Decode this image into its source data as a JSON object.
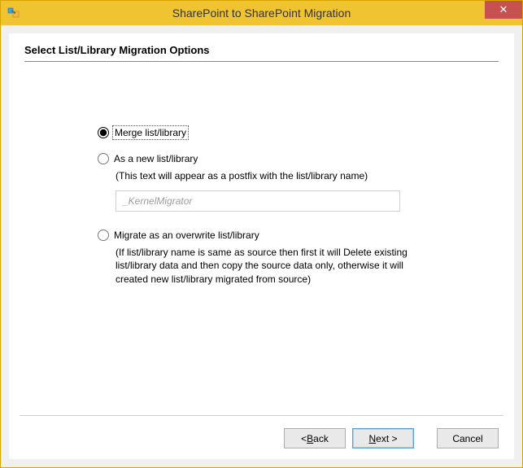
{
  "window": {
    "title": "SharePoint to SharePoint Migration",
    "close_glyph": "✕"
  },
  "page": {
    "heading": "Select List/Library Migration Options"
  },
  "options": {
    "merge": {
      "label": "Merge list/library",
      "checked": true
    },
    "new": {
      "label": "As a new list/library",
      "hint": "(This text will appear as a postfix with the list/library name)",
      "postfix_value": "_KernelMigrator"
    },
    "overwrite": {
      "label": "Migrate as an overwrite list/library",
      "hint": "(If list/library name is same as source then first it will Delete existing list/library data   and then copy the source data only, otherwise it will created new list/library migrated from source)"
    }
  },
  "buttons": {
    "back_prefix": "< ",
    "back_letter": "B",
    "back_rest": "ack",
    "next_letter": "N",
    "next_rest": "ext >",
    "cancel": "Cancel"
  }
}
